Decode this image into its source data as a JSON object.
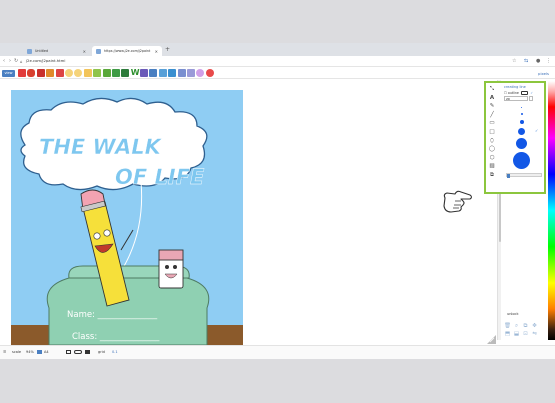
{
  "browser": {
    "tabs": [
      {
        "title": "Untitled",
        "active": false
      },
      {
        "title": "https://www.j2e.com/j2paint",
        "active": true
      }
    ],
    "url": "j2e.com/j2paint.html"
  },
  "toolbar": {
    "view_label": "view",
    "right_link": "pixels"
  },
  "artwork": {
    "title_line1": "THE WALK",
    "title_line2": "OF LIFE",
    "name_label": "Name: ______________",
    "class_label": "Class: ______________"
  },
  "tools_panel": {
    "title": "creating line",
    "outline_label": "outline",
    "size_value": "20",
    "brush_sizes": [
      1,
      2,
      4,
      7,
      11,
      17
    ]
  },
  "sidebar": {
    "unlock_label": "unlock"
  },
  "statusbar": {
    "scale_label": "scale",
    "scale_value": "94%",
    "paper_value": "A4",
    "grid_label": "grid",
    "grid_value": "0.1"
  },
  "colors": {
    "accent_blue": "#1257e6",
    "panel_border": "#8cc63e",
    "sky": "#8fcdf3",
    "sofa": "#8fd0b2",
    "pencil_yellow": "#f6e03a"
  }
}
